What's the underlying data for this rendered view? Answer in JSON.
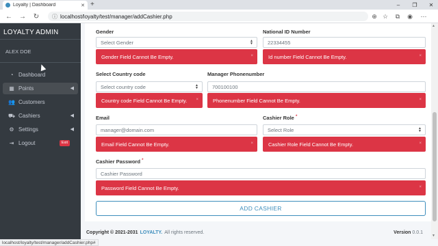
{
  "browser": {
    "tab_title": "Loyalty | Dashboard",
    "tab_close": "✕",
    "new_tab": "+",
    "url": "localhost/loyalty/test/manager/addCashier.php",
    "status_url": "localhost/loyalty/test/manager/addCashier.php#"
  },
  "sidebar": {
    "brand": "LOYALTY ADMIN",
    "user": "ALEX DOE",
    "items": [
      {
        "label": "Dashboard",
        "icon": "tachometer-icon"
      },
      {
        "label": "Points",
        "icon": "table-icon"
      },
      {
        "label": "Customers",
        "icon": "users-icon"
      },
      {
        "label": "Cashiers",
        "icon": "cart-icon"
      },
      {
        "label": "Settings",
        "icon": "cogs-icon"
      },
      {
        "label": "Logout",
        "icon": "sign-out-icon",
        "badge": "Exit"
      }
    ]
  },
  "form": {
    "gender": {
      "label": "Gender",
      "placeholder": "Select Gender",
      "error": "Gender Field Cannot Be Empty."
    },
    "national_id": {
      "label": "National ID Number",
      "placeholder": "22334455",
      "error": "Id number Field Cannot Be Empty."
    },
    "country_code": {
      "label": "Select Country code",
      "placeholder": "Select country code",
      "error": "Country code Field Cannot Be Empty."
    },
    "phone": {
      "label": "Manager Phonenumber",
      "placeholder": "700100100",
      "error": "Phonenumber Field Cannot Be Empty."
    },
    "email": {
      "label": "Email",
      "placeholder": "manager@domain.com",
      "error": "Email Field Cannot Be Empty."
    },
    "role": {
      "label": "Cashier Role",
      "required": "*",
      "placeholder": "Select Role",
      "error": "Cashier Role Field Cannot Be Empty."
    },
    "password": {
      "label": "Cashier Password",
      "required": "*",
      "placeholder": "Cashier Password",
      "error": "Password Field Cannot Be Empty."
    },
    "submit": "ADD CASHIER",
    "close_mark": "×"
  },
  "footer": {
    "copyright": "Copyright © 2021-2031",
    "brand": "LOYALTY.",
    "rights": "All rights reserved.",
    "version_label": "Version",
    "version": "0.0.1"
  },
  "colors": {
    "error": "#dc3545",
    "sidebar": "#343a40",
    "accent": "#3c8dbc"
  }
}
